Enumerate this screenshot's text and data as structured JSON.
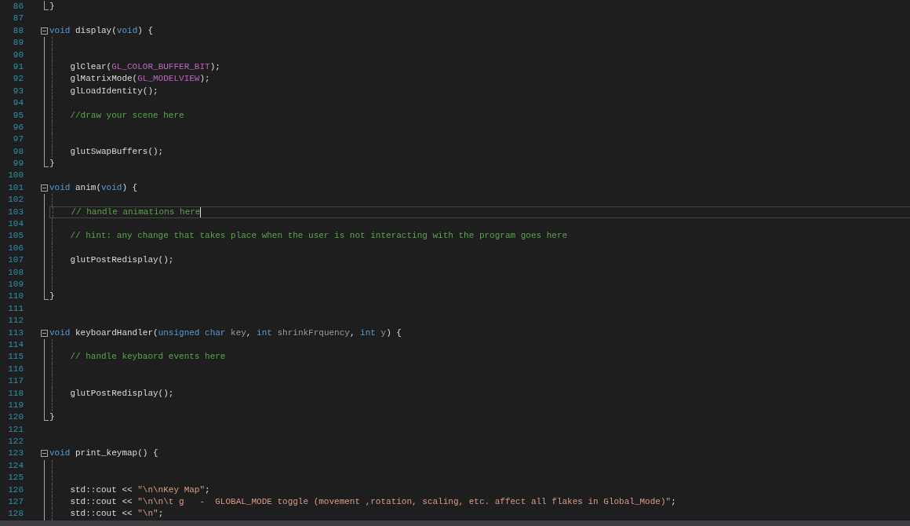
{
  "editor": {
    "lines": [
      {
        "number": "86",
        "kind": "block_end",
        "current": false,
        "tokens": [
          {
            "kind": "plain",
            "text": "}"
          }
        ]
      },
      {
        "number": "87",
        "kind": "blank",
        "current": false
      },
      {
        "number": "88",
        "kind": "block_start",
        "current": false,
        "tokens": [
          {
            "kind": "keyword",
            "text": "void"
          },
          {
            "kind": "plain",
            "text": " display("
          },
          {
            "kind": "keyword",
            "text": "void"
          },
          {
            "kind": "plain",
            "text": ") {"
          }
        ]
      },
      {
        "number": "89",
        "kind": "block_line",
        "current": false
      },
      {
        "number": "90",
        "kind": "block_line",
        "current": false
      },
      {
        "number": "91",
        "kind": "block_line",
        "current": false,
        "tokens": [
          {
            "kind": "plain",
            "text": "    glClear("
          },
          {
            "kind": "macro",
            "text": "GL_COLOR_BUFFER_BIT"
          },
          {
            "kind": "plain",
            "text": ");"
          }
        ]
      },
      {
        "number": "92",
        "kind": "block_line",
        "current": false,
        "tokens": [
          {
            "kind": "plain",
            "text": "    glMatrixMode("
          },
          {
            "kind": "macro",
            "text": "GL_MODELVIEW"
          },
          {
            "kind": "plain",
            "text": ");"
          }
        ]
      },
      {
        "number": "93",
        "kind": "block_line",
        "current": false,
        "tokens": [
          {
            "kind": "plain",
            "text": "    glLoadIdentity();"
          }
        ]
      },
      {
        "number": "94",
        "kind": "block_line",
        "current": false
      },
      {
        "number": "95",
        "kind": "block_line",
        "current": false,
        "tokens": [
          {
            "kind": "comment",
            "text": "    //draw your scene here"
          }
        ]
      },
      {
        "number": "96",
        "kind": "block_line",
        "current": false
      },
      {
        "number": "97",
        "kind": "block_line",
        "current": false
      },
      {
        "number": "98",
        "kind": "block_line",
        "current": false,
        "tokens": [
          {
            "kind": "plain",
            "text": "    glutSwapBuffers();"
          }
        ]
      },
      {
        "number": "99",
        "kind": "block_end",
        "current": false,
        "tokens": [
          {
            "kind": "plain",
            "text": "}"
          }
        ]
      },
      {
        "number": "100",
        "kind": "blank",
        "current": false
      },
      {
        "number": "101",
        "kind": "block_start",
        "current": false,
        "tokens": [
          {
            "kind": "keyword",
            "text": "void"
          },
          {
            "kind": "plain",
            "text": " anim("
          },
          {
            "kind": "keyword",
            "text": "void"
          },
          {
            "kind": "plain",
            "text": ") {"
          }
        ]
      },
      {
        "number": "102",
        "kind": "block_line",
        "current": false
      },
      {
        "number": "103",
        "kind": "block_line",
        "current": true,
        "tokens": [
          {
            "kind": "comment",
            "text": "    // handle animations here"
          }
        ]
      },
      {
        "number": "104",
        "kind": "block_line",
        "current": false
      },
      {
        "number": "105",
        "kind": "block_line",
        "current": false,
        "tokens": [
          {
            "kind": "comment",
            "text": "    // hint: any change that takes place when the user is not interacting with the program goes here"
          }
        ]
      },
      {
        "number": "106",
        "kind": "block_line",
        "current": false
      },
      {
        "number": "107",
        "kind": "block_line",
        "current": false,
        "tokens": [
          {
            "kind": "plain",
            "text": "    glutPostRedisplay();"
          }
        ]
      },
      {
        "number": "108",
        "kind": "block_line",
        "current": false
      },
      {
        "number": "109",
        "kind": "block_line",
        "current": false
      },
      {
        "number": "110",
        "kind": "block_end",
        "current": false,
        "tokens": [
          {
            "kind": "plain",
            "text": "}"
          }
        ]
      },
      {
        "number": "111",
        "kind": "blank",
        "current": false
      },
      {
        "number": "112",
        "kind": "blank",
        "current": false
      },
      {
        "number": "113",
        "kind": "block_start",
        "current": false,
        "tokens": [
          {
            "kind": "keyword",
            "text": "void"
          },
          {
            "kind": "plain",
            "text": " keyboardHandler("
          },
          {
            "kind": "keyword",
            "text": "unsigned"
          },
          {
            "kind": "keyword",
            "text": " char"
          },
          {
            "kind": "param",
            "text": " key"
          },
          {
            "kind": "plain",
            "text": ", "
          },
          {
            "kind": "keyword",
            "text": "int"
          },
          {
            "kind": "param",
            "text": " shrinkFrquency"
          },
          {
            "kind": "plain",
            "text": ", "
          },
          {
            "kind": "keyword",
            "text": "int"
          },
          {
            "kind": "param",
            "text": " y"
          },
          {
            "kind": "plain",
            "text": ") {"
          }
        ]
      },
      {
        "number": "114",
        "kind": "block_line",
        "current": false
      },
      {
        "number": "115",
        "kind": "block_line",
        "current": false,
        "tokens": [
          {
            "kind": "comment",
            "text": "    // handle keybaord events here"
          }
        ]
      },
      {
        "number": "116",
        "kind": "block_line",
        "current": false
      },
      {
        "number": "117",
        "kind": "block_line",
        "current": false
      },
      {
        "number": "118",
        "kind": "block_line",
        "current": false,
        "tokens": [
          {
            "kind": "plain",
            "text": "    glutPostRedisplay();"
          }
        ]
      },
      {
        "number": "119",
        "kind": "block_line",
        "current": false
      },
      {
        "number": "120",
        "kind": "block_end",
        "current": false,
        "tokens": [
          {
            "kind": "plain",
            "text": "}"
          }
        ]
      },
      {
        "number": "121",
        "kind": "blank",
        "current": false
      },
      {
        "number": "122",
        "kind": "blank",
        "current": false
      },
      {
        "number": "123",
        "kind": "block_start",
        "current": false,
        "tokens": [
          {
            "kind": "keyword",
            "text": "void"
          },
          {
            "kind": "plain",
            "text": " print_keymap() {"
          }
        ]
      },
      {
        "number": "124",
        "kind": "block_line",
        "current": false
      },
      {
        "number": "125",
        "kind": "block_line",
        "current": false
      },
      {
        "number": "126",
        "kind": "block_line",
        "current": false,
        "tokens": [
          {
            "kind": "plain",
            "text": "    std::cout << "
          },
          {
            "kind": "string",
            "text": "\"\\n\\nKey Map\""
          },
          {
            "kind": "plain",
            "text": ";"
          }
        ]
      },
      {
        "number": "127",
        "kind": "block_line",
        "current": false,
        "tokens": [
          {
            "kind": "plain",
            "text": "    std::cout << "
          },
          {
            "kind": "string",
            "text": "\"\\n\\n\\t g   -  GLOBAL_MODE toggle (movement ,rotation, scaling, etc. affect all flakes in Global_Mode)\""
          },
          {
            "kind": "plain",
            "text": ";"
          }
        ]
      },
      {
        "number": "128",
        "kind": "block_line",
        "current": false,
        "tokens": [
          {
            "kind": "plain",
            "text": "    std::cout << "
          },
          {
            "kind": "string",
            "text": "\"\\n\""
          },
          {
            "kind": "plain",
            "text": ";"
          }
        ]
      }
    ]
  }
}
